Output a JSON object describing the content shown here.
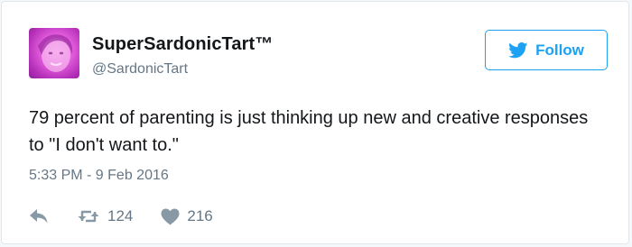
{
  "user": {
    "display_name": "SuperSardonicTart™",
    "handle": "@SardonicTart"
  },
  "follow_button": {
    "label": "Follow"
  },
  "tweet": {
    "text": "79 percent of parenting is just thinking up new and creative responses to \"I don't want to.\"",
    "timestamp": "5:33 PM - 9 Feb 2016"
  },
  "actions": {
    "reply_icon": "reply-icon",
    "retweet_icon": "retweet-icon",
    "retweet_count": "124",
    "like_icon": "heart-icon",
    "like_count": "216"
  },
  "colors": {
    "accent": "#1da1f2",
    "text": "#14171a",
    "muted": "#657786",
    "icon": "#8899a6"
  }
}
